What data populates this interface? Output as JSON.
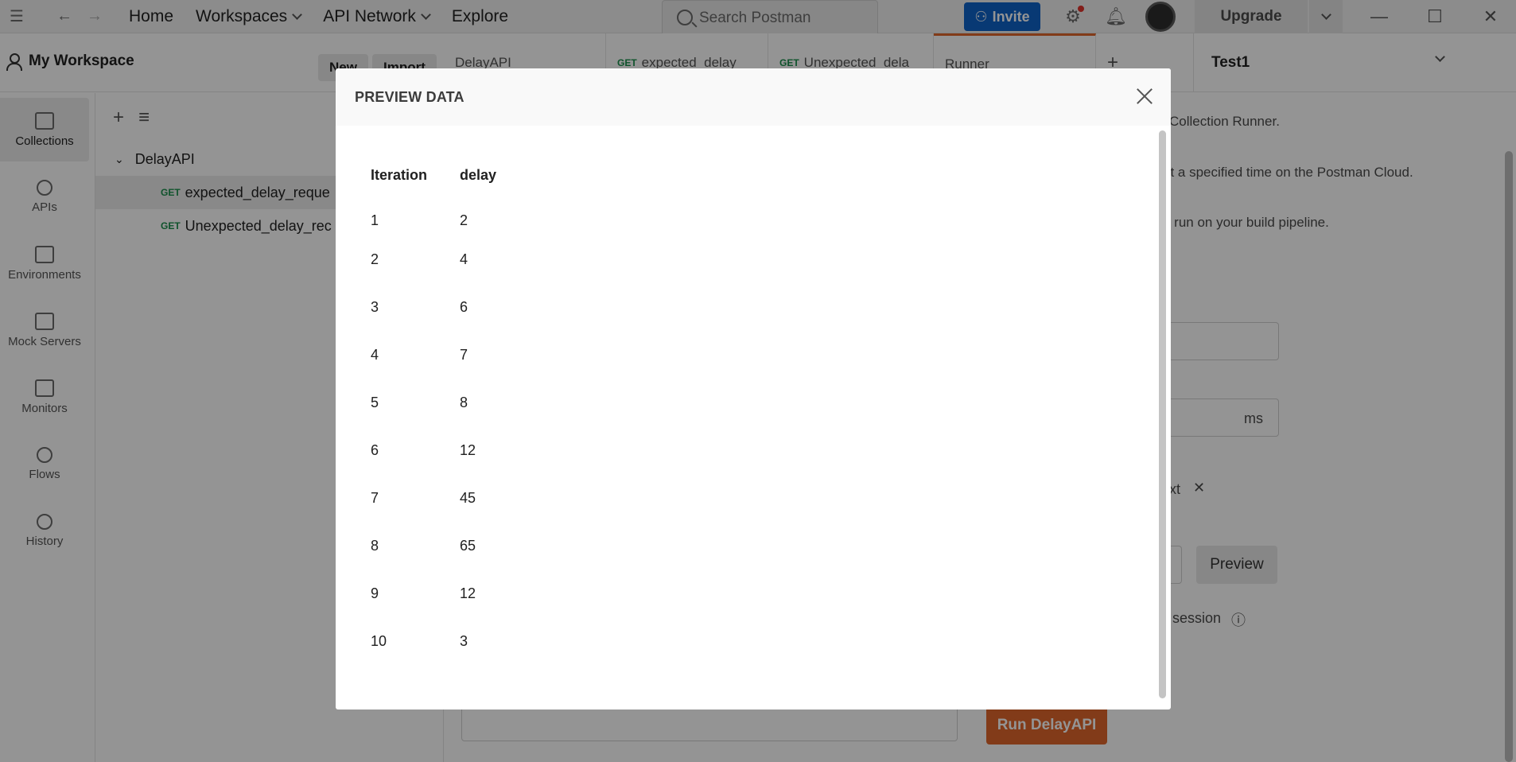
{
  "header": {
    "home": "Home",
    "workspaces": "Workspaces",
    "api_network": "API Network",
    "explore": "Explore",
    "search_placeholder": "Search Postman",
    "invite": "Invite",
    "upgrade": "Upgrade"
  },
  "workspace": {
    "name": "My Workspace",
    "new_button": "New",
    "import_button": "Import",
    "tabs": [
      {
        "method": "",
        "label": "DelayAPI"
      },
      {
        "method": "GET",
        "label": "expected_delay"
      },
      {
        "method": "GET",
        "label": "Unexpected_dela"
      },
      {
        "method": "",
        "label": "Runner"
      }
    ],
    "environment": "Test1"
  },
  "sidebar": {
    "items": [
      {
        "label": "Collections"
      },
      {
        "label": "APIs"
      },
      {
        "label": "Environments"
      },
      {
        "label": "Mock Servers"
      },
      {
        "label": "Monitors"
      },
      {
        "label": "Flows"
      },
      {
        "label": "History"
      }
    ],
    "collection": {
      "name": "DelayAPI",
      "requests": [
        {
          "method": "GET",
          "name": "expected_delay_reque"
        },
        {
          "method": "GET",
          "name": "Unexpected_delay_rec"
        }
      ]
    }
  },
  "runner": {
    "line1": "Collection Runner.",
    "line2": "at a specified time on the Postman Cloud.",
    "line3": "o run on your build pipeline.",
    "delay_unit": "ms",
    "file_suffix": "xt",
    "preview_button": "Preview",
    "session_label": "session",
    "run_button": "Run DelayAPI"
  },
  "modal": {
    "title": "PREVIEW DATA",
    "columns": [
      "Iteration",
      "delay"
    ],
    "rows": [
      [
        "1",
        "2"
      ],
      [
        "2",
        "4"
      ],
      [
        "3",
        "6"
      ],
      [
        "4",
        "7"
      ],
      [
        "5",
        "8"
      ],
      [
        "6",
        "12"
      ],
      [
        "7",
        "45"
      ],
      [
        "8",
        "65"
      ],
      [
        "9",
        "12"
      ],
      [
        "10",
        "3"
      ]
    ]
  }
}
